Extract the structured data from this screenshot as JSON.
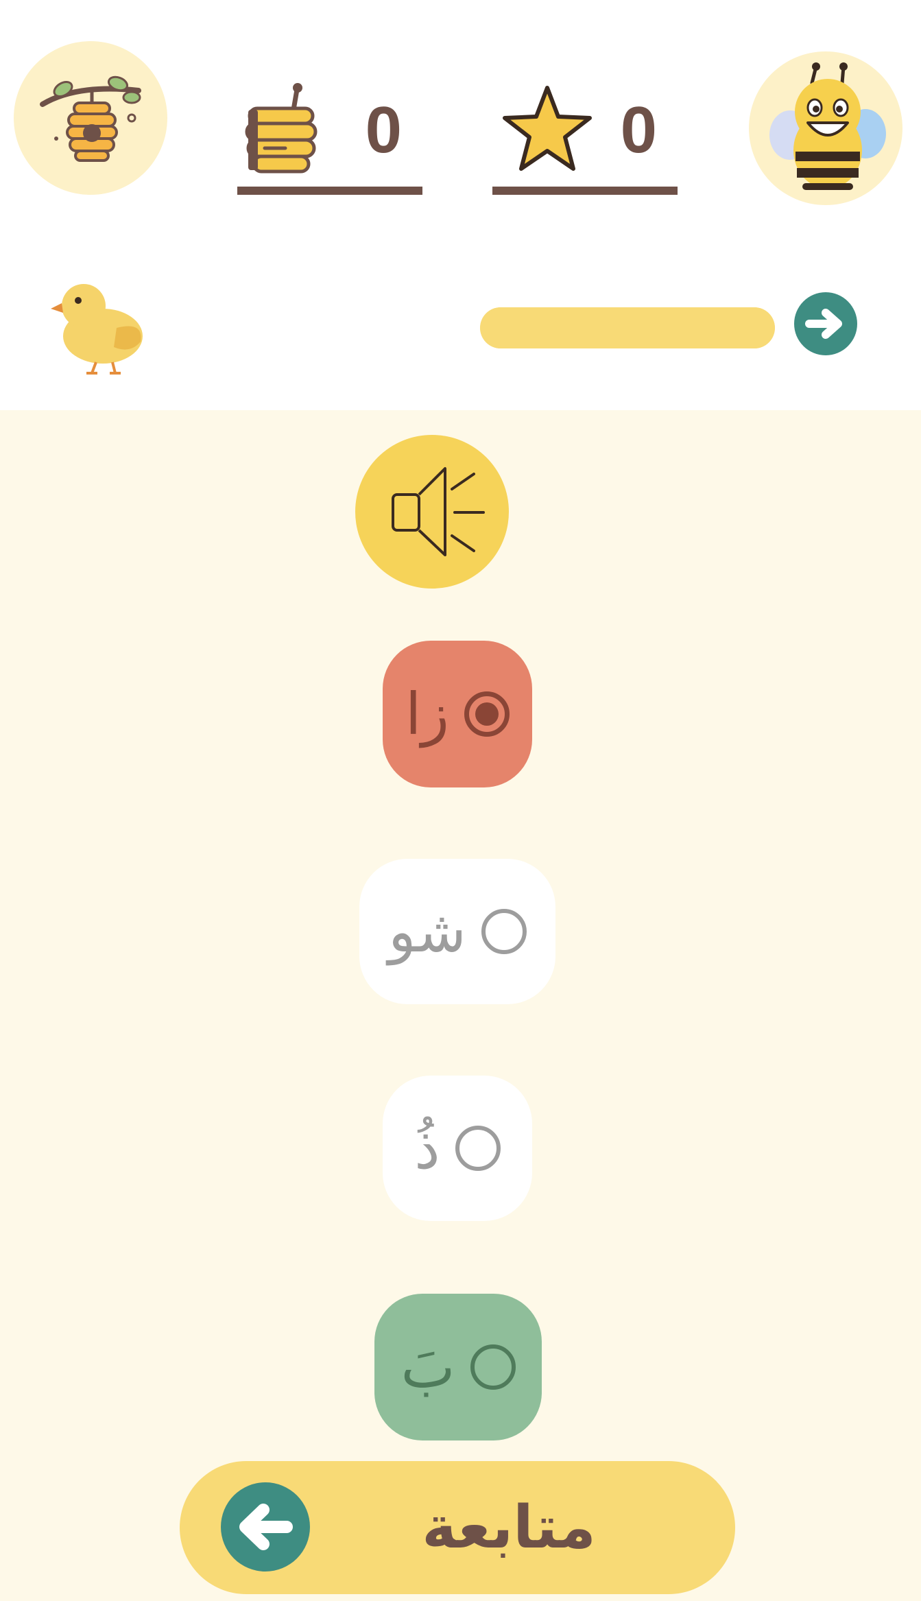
{
  "header": {
    "honey_count": "0",
    "star_count": "0"
  },
  "progress": {
    "fraction": 1.0
  },
  "quiz": {
    "options": [
      {
        "label": "زا",
        "state": "selected"
      },
      {
        "label": "شو",
        "state": "default"
      },
      {
        "label": "ذُ",
        "state": "default"
      },
      {
        "label": "بَ",
        "state": "correct"
      }
    ]
  },
  "footer": {
    "continue_label": "متابعة"
  },
  "colors": {
    "accent_yellow": "#F8DA76",
    "panel_bg": "#FEF9E8",
    "teal": "#3E8D82",
    "brown": "#6E5148",
    "wrong": "#E5846B",
    "correct": "#8FBE9A"
  },
  "icons": [
    "beehive-icon",
    "honey-jar-icon",
    "star-icon",
    "bee-avatar-icon",
    "chick-icon",
    "arrow-right-icon",
    "speaker-icon",
    "arrow-left-icon"
  ]
}
